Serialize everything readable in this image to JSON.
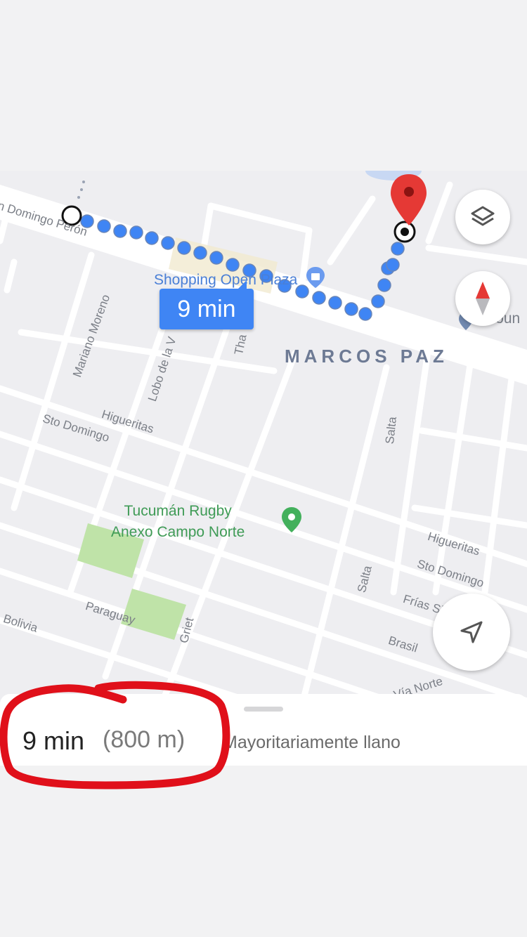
{
  "map": {
    "streets": {
      "domingo_peron": "n Domingo Perón",
      "mariano_moreno": "Mariano Moreno",
      "lobo_de_la_vega": "Lobo de la V",
      "thames": "Tha",
      "higueritas_1": "Higueritas",
      "sto_domingo_1": "Sto Domingo",
      "salta_1": "Salta",
      "higueritas_2": "Higueritas",
      "sto_domingo_2": "Sto Domingo",
      "frias_silva": "Frías Silva",
      "salta_2": "Salta",
      "paraguay": "Paraguay",
      "griet": "Griet",
      "bolivia": "Bolivia",
      "brasil": "Brasil",
      "via_norte": "Vía Norte"
    },
    "area_label": "MARCOS PAZ",
    "poi_shopping": "Shopping Open Plaza",
    "poi_rugby_line1": "Tucumán Rugby",
    "poi_rugby_line2": "Anexo Campo Norte",
    "poi_partial": "Coun",
    "route_eta_badge": "9 min"
  },
  "controls": {
    "layers_icon": "layers-icon",
    "compass_icon": "compass-icon",
    "my_location_icon": "navigation-arrow-icon"
  },
  "summary": {
    "duration": "9 min",
    "distance": "(800 m)",
    "terrain": "Mayoritariamente llano"
  },
  "colors": {
    "route": "#3f85f4",
    "destination_pin": "#e53935",
    "park": "#bfe3a8",
    "annotation": "#e0101a"
  }
}
